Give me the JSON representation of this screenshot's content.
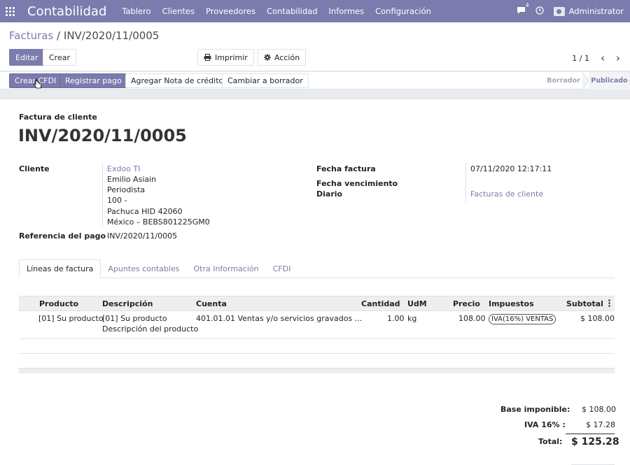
{
  "navbar": {
    "app_name": "Contabilidad",
    "menu": [
      "Tablero",
      "Clientes",
      "Proveedores",
      "Contabilidad",
      "Informes",
      "Configuración"
    ],
    "chat_count": "4",
    "user": "Administrator"
  },
  "control": {
    "breadcrumb_parent": "Facturas",
    "breadcrumb_separator": "/",
    "breadcrumb_current": "INV/2020/11/0005",
    "edit_label": "Editar",
    "create_label": "Crear",
    "print_label": "Imprimir",
    "action_label": "Acción",
    "pager": "1 / 1",
    "prev_icon": "‹",
    "next_icon": "›"
  },
  "statusbar": {
    "buttons": [
      "Crear CFDI",
      "Registrar pago",
      "Agregar Nota de crédito",
      "Cambiar a borrador"
    ],
    "stages": [
      "Borrador",
      "Publicado"
    ],
    "active_stage": "Publicado"
  },
  "invoice": {
    "type": "Factura de cliente",
    "number": "INV/2020/11/0005",
    "customer_label": "Cliente",
    "customer_name": "Exdoo TI",
    "address_lines": [
      "Emilio Asiain",
      "Periodista",
      "100 -",
      "Pachuca HID 42060",
      "México – BEBS801225GM0"
    ],
    "payment_ref_label": "Referencia del pago",
    "payment_ref": "INV/2020/11/0005",
    "date_label": "Fecha factura",
    "date_value": "07/11/2020 12:17:11",
    "due_label": "Fecha vencimiento",
    "due_value": "",
    "journal_label": "Diario",
    "journal_value": "Facturas de cliente"
  },
  "tabs": [
    "Líneas de factura",
    "Apuntes contables",
    "Otra Información",
    "CFDI"
  ],
  "lines": {
    "headers": [
      "Producto",
      "Descripción",
      "Cuenta",
      "Cantidad",
      "UdM",
      "Precio",
      "Impuestos",
      "Subtotal"
    ],
    "rows": [
      {
        "product": "[01] Su producto",
        "description_1": "[01] Su producto",
        "description_2": "Descripción del producto",
        "account": "401.01.01 Ventas y/o servicios gravados ...",
        "quantity": "1.00",
        "uom": "kg",
        "price": "108.00",
        "tax": "IVA(16%) VENTAS",
        "subtotal": "$ 108.00"
      }
    ]
  },
  "totals": {
    "base_label": "Base imponible:",
    "base_value": "$ 108.00",
    "tax_label": "IVA 16% :",
    "tax_value": "$ 17.28",
    "total_label": "Total:",
    "total_value": "$ 125.28"
  }
}
